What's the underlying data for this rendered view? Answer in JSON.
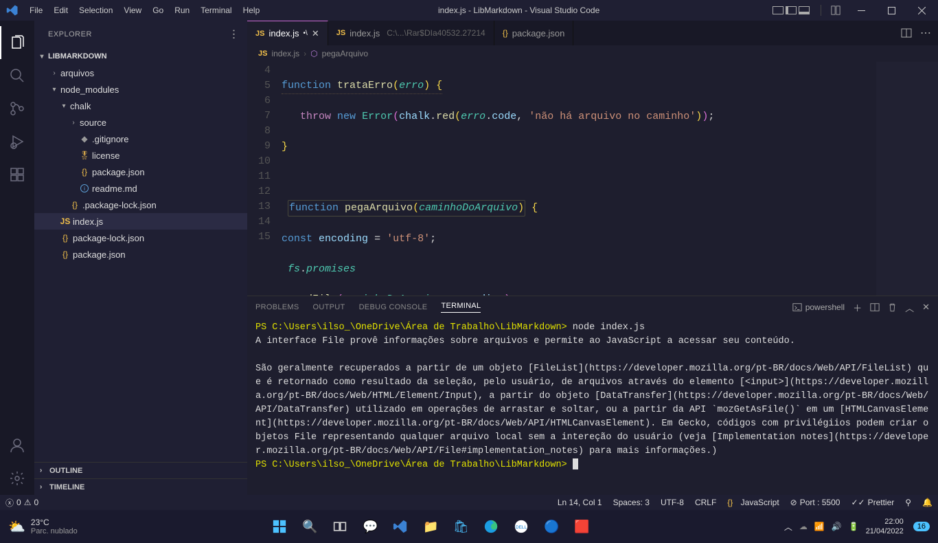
{
  "titlebar": {
    "menu": [
      "File",
      "Edit",
      "Selection",
      "View",
      "Go",
      "Run",
      "Terminal",
      "Help"
    ],
    "title": "index.js - LibMarkdown - Visual Studio Code"
  },
  "activitybar": {
    "items": [
      "explorer",
      "search",
      "source-control",
      "run-debug",
      "extensions"
    ],
    "bottom": [
      "account",
      "settings"
    ]
  },
  "sidebar": {
    "header": "EXPLORER",
    "root": "LIBMARKDOWN",
    "tree": [
      {
        "type": "folder",
        "label": "arquivos",
        "open": false,
        "indent": 1
      },
      {
        "type": "folder",
        "label": "node_modules",
        "open": true,
        "indent": 1
      },
      {
        "type": "folder",
        "label": "chalk",
        "open": true,
        "indent": 2
      },
      {
        "type": "folder",
        "label": "source",
        "open": false,
        "indent": 3
      },
      {
        "type": "file",
        "label": ".gitignore",
        "icon": "git",
        "indent": 3
      },
      {
        "type": "file",
        "label": "license",
        "icon": "cert",
        "indent": 3
      },
      {
        "type": "file",
        "label": "package.json",
        "icon": "json",
        "indent": 3
      },
      {
        "type": "file",
        "label": "readme.md",
        "icon": "info",
        "indent": 3
      },
      {
        "type": "file",
        "label": ".package-lock.json",
        "icon": "json",
        "indent": 2
      },
      {
        "type": "file",
        "label": "index.js",
        "icon": "js",
        "indent": 1,
        "selected": true
      },
      {
        "type": "file",
        "label": "package-lock.json",
        "icon": "json",
        "indent": 1
      },
      {
        "type": "file",
        "label": "package.json",
        "icon": "json",
        "indent": 1
      }
    ],
    "sections": [
      "OUTLINE",
      "TIMELINE"
    ]
  },
  "tabs": [
    {
      "label": "index.js",
      "icon": "js",
      "modified": true,
      "active": true,
      "close": true
    },
    {
      "label": "index.js",
      "icon": "js",
      "hint": "C:\\...\\Rar$DIa40532.27214"
    },
    {
      "label": "package.json",
      "icon": "json"
    }
  ],
  "breadcrumb": {
    "file": "index.js",
    "symbol": "pegaArquivo"
  },
  "code": {
    "lines": [
      4,
      5,
      6,
      7,
      8,
      9,
      10,
      11,
      12,
      13,
      14,
      15
    ]
  },
  "panel": {
    "tabs": [
      "PROBLEMS",
      "OUTPUT",
      "DEBUG CONSOLE",
      "TERMINAL"
    ],
    "active": 3,
    "shell": "powershell",
    "content": {
      "line1_prompt": "PS C:\\Users\\ilso_\\OneDrive\\Área de Trabalho\\LibMarkdown>",
      "line1_cmd": " node index.js",
      "line2": "A interface File provê informações sobre arquivos e permite ao JavaScript  a acessar seu conteúdo.",
      "para": "São geralmente recuperados a partir de um objeto [FileList](https://developer.mozilla.org/pt-BR/docs/Web/API/FileList) que é retornado como resultado da seleção, pelo usuário, de arquivos através do elemento [<input>](https://developer.mozilla.org/pt-BR/docs/Web/HTML/Element/Input), a partir do objeto [DataTransfer](https://developer.mozilla.org/pt-BR/docs/Web/API/DataTransfer) utilizado em operações de arrastar e soltar, ou a partir da API `mozGetAsFile()` em um [HTMLCanvasElement](https://developer.mozilla.org/pt-BR/docs/Web/API/HTMLCanvasElement). Em Gecko, códigos com privilégiios podem criar objetos File representando qualquer arquivo local sem a intereção do usuário (veja [Implementation notes](https://developer.mozilla.org/pt-BR/docs/Web/API/File#implementation_notes) para mais informações.)",
      "last_prompt": "PS C:\\Users\\ilso_\\OneDrive\\Área de Trabalho\\LibMarkdown>"
    }
  },
  "statusbar": {
    "errors": "0",
    "warnings": "0",
    "linecol": "Ln 14, Col 1",
    "spaces": "Spaces: 3",
    "encoding": "UTF-8",
    "eol": "CRLF",
    "lang": "JavaScript",
    "port": "Port : 5500",
    "prettier": "Prettier"
  },
  "taskbar": {
    "temp": "23°C",
    "weather": "Parc. nublado",
    "time": "22:00",
    "date": "21/04/2022",
    "notif": "16"
  }
}
